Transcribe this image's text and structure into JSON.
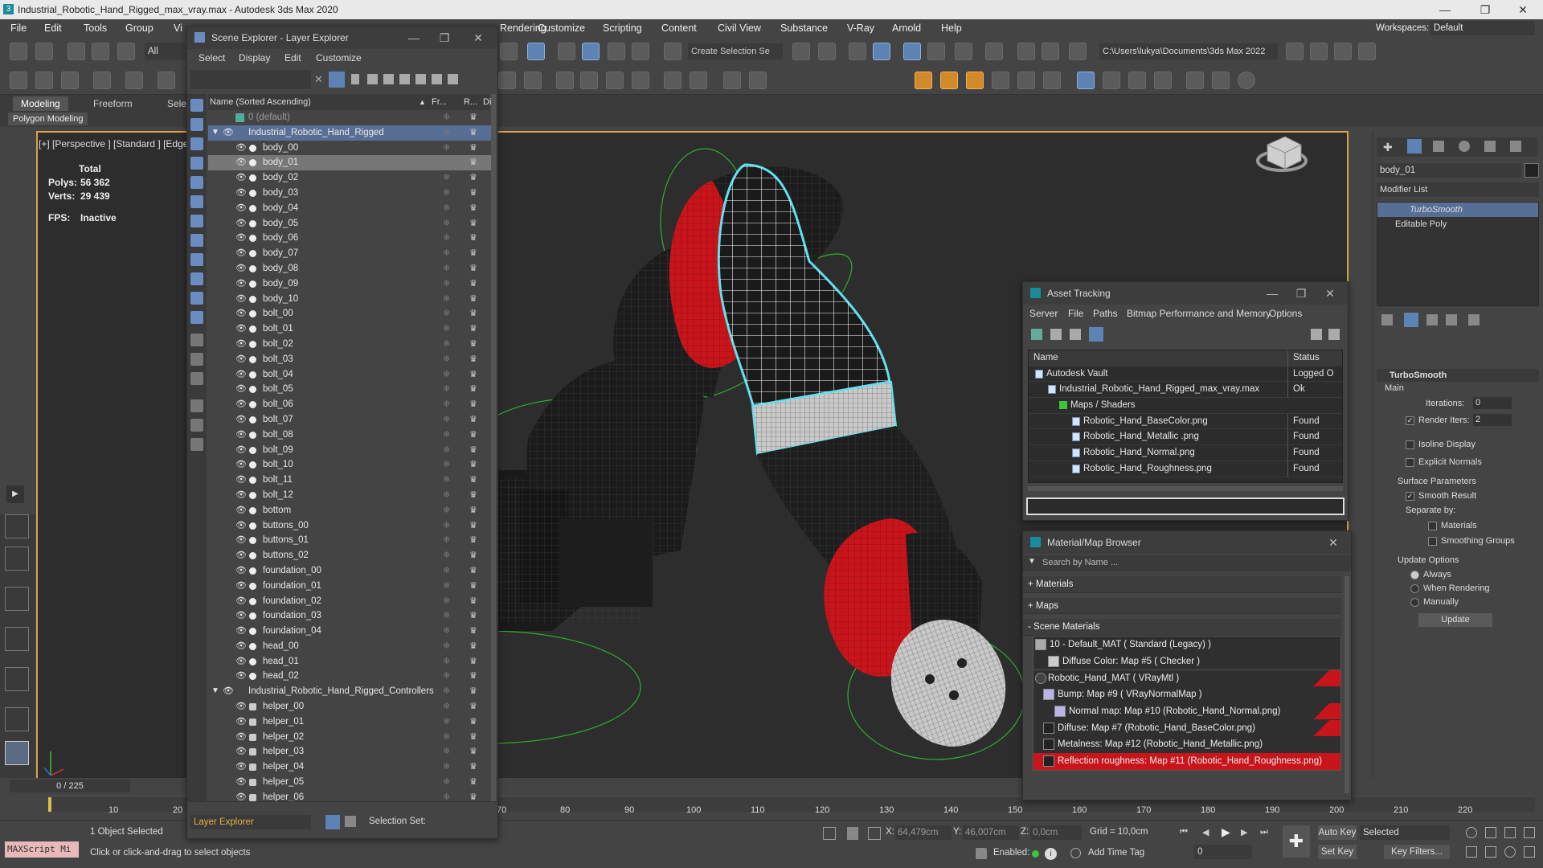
{
  "window": {
    "title": "Industrial_Robotic_Hand_Rigged_max_vray.max - Autodesk 3ds Max 2020",
    "minimize": "—",
    "maximize": "❐",
    "close": "✕"
  },
  "menubar": {
    "items": [
      "File",
      "Edit",
      "Tools",
      "Group",
      "Vi",
      "Customize",
      "Scripting",
      "Content",
      "Civil View",
      "Substance",
      "V-Ray",
      "Arnold",
      "Help"
    ],
    "partial": [
      "Rendering"
    ],
    "workspace_label": "Workspaces:",
    "workspace_value": "Default"
  },
  "toolbar": {
    "filter_value": "All",
    "selection_set_placeholder": "Create Selection Se",
    "project_path": "C:\\Users\\lukya\\Documents\\3ds Max 2022"
  },
  "ribbon": {
    "tabs": [
      "Modeling",
      "Freeform",
      "Sele"
    ],
    "active_tab": "Modeling",
    "subtab": "Polygon Modeling"
  },
  "viewport": {
    "label": "[+] [Perspective ] [Standard ] [Edge",
    "stats_total": "Total",
    "polys_label": "Polys:",
    "polys_value": "56 362",
    "verts_label": "Verts:",
    "verts_value": "29 439",
    "fps_label": "FPS:",
    "fps_value": "Inactive"
  },
  "scene_explorer": {
    "title": "Scene Explorer - Layer Explorer",
    "menu": [
      "Select",
      "Display",
      "Edit",
      "Customize"
    ],
    "col_name": "Name (Sorted Ascending)",
    "col_frozen": "Fr...",
    "col_render": "R...",
    "col_disp": "Di",
    "default_layer": "0 (default)",
    "layer1": "Industrial_Robotic_Hand_Rigged",
    "objects": [
      "body_00",
      "body_01",
      "body_02",
      "body_03",
      "body_04",
      "body_05",
      "body_06",
      "body_07",
      "body_08",
      "body_09",
      "body_10",
      "bolt_00",
      "bolt_01",
      "bolt_02",
      "bolt_03",
      "bolt_04",
      "bolt_05",
      "bolt_06",
      "bolt_07",
      "bolt_08",
      "bolt_09",
      "bolt_10",
      "bolt_11",
      "bolt_12",
      "bottom",
      "buttons_00",
      "buttons_01",
      "buttons_02",
      "foundation_00",
      "foundation_01",
      "foundation_02",
      "foundation_03",
      "foundation_04",
      "head_00",
      "head_01",
      "head_02"
    ],
    "layer2": "Industrial_Robotic_Hand_Rigged_Controllers",
    "helpers": [
      "helper_00",
      "helper_01",
      "helper_02",
      "helper_03",
      "helper_04",
      "helper_05",
      "helper_06"
    ],
    "footer_explorer": "Layer Explorer",
    "footer_selset": "Selection Set:"
  },
  "asset_tracking": {
    "title": "Asset Tracking",
    "menu": [
      "Server",
      "File",
      "Paths",
      "Bitmap Performance and Memory",
      "Options"
    ],
    "col_name": "Name",
    "col_status": "Status",
    "rows": [
      {
        "name": "Autodesk Vault",
        "status": "Logged O"
      },
      {
        "name": "Industrial_Robotic_Hand_Rigged_max_vray.max",
        "status": "Ok"
      },
      {
        "name": "Maps / Shaders",
        "status": ""
      },
      {
        "name": "Robotic_Hand_BaseColor.png",
        "status": "Found"
      },
      {
        "name": "Robotic_Hand_Metallic .png",
        "status": "Found"
      },
      {
        "name": "Robotic_Hand_Normal.png",
        "status": "Found"
      },
      {
        "name": "Robotic_Hand_Roughness.png",
        "status": "Found"
      }
    ]
  },
  "material_browser": {
    "title": "Material/Map Browser",
    "search_placeholder": "Search by Name ...",
    "cat_materials": "+ Materials",
    "cat_maps": "+ Maps",
    "cat_scene": "- Scene Materials",
    "items": [
      "10 - Default_MAT  ( Standard (Legacy) )",
      "Diffuse Color: Map #5  ( Checker )",
      "Robotic_Hand_MAT  ( VRayMtl )",
      "Bump: Map #9  ( VRayNormalMap )",
      "Normal map: Map #10 (Robotic_Hand_Normal.png)",
      "Diffuse: Map #7 (Robotic_Hand_BaseColor.png)",
      "Metalness: Map #12 (Robotic_Hand_Metallic.png)",
      "Reflection roughness: Map #11 (Robotic_Hand_Roughness.png)"
    ]
  },
  "command_panel": {
    "object_name": "body_01",
    "modifier_list": "Modifier List",
    "stack": [
      "TurboSmooth",
      "Editable Poly"
    ],
    "rollout_title": "TurboSmooth",
    "main": "Main",
    "iterations_label": "Iterations:",
    "iterations_value": "0",
    "render_iters_label": "Render Iters:",
    "render_iters_value": "2",
    "isoline": "Isoline Display",
    "explicit_normals": "Explicit Normals",
    "surface_params": "Surface Parameters",
    "smooth_result": "Smooth Result",
    "separate_by": "Separate by:",
    "materials": "Materials",
    "smoothing_groups": "Smoothing Groups",
    "update_options": "Update Options",
    "always": "Always",
    "when_rendering": "When Rendering",
    "manually": "Manually",
    "update_button": "Update"
  },
  "timeline": {
    "frame_counter": "0 / 225",
    "ticks": [
      "10",
      "20",
      "70",
      "80",
      "90",
      "100",
      "110",
      "120",
      "130",
      "140",
      "150",
      "160",
      "170",
      "180",
      "190",
      "200",
      "210",
      "220"
    ]
  },
  "statusbar": {
    "maxscript": "MAXScript Mi",
    "selected": "1 Object Selected",
    "prompt": "Click or click-and-drag to select objects",
    "x_label": "X:",
    "x_value": "64,479cm",
    "y_label": "Y:",
    "y_value": "46,007cm",
    "z_label": "Z:",
    "z_value": "0,0cm",
    "grid": "Grid = 10,0cm",
    "enabled": "Enabled:",
    "add_time_tag": "Add Time Tag",
    "auto_key": "Auto Key",
    "set_key": "Set Key",
    "selected_dropdown": "Selected",
    "key_filters": "Key Filters...",
    "frame_field": "0"
  },
  "colors": {
    "accent_blue": "#586f95",
    "viewport_border": "#d8a24a",
    "robot_red": "#c8141b",
    "selection_cyan": "#5ee0f0"
  }
}
